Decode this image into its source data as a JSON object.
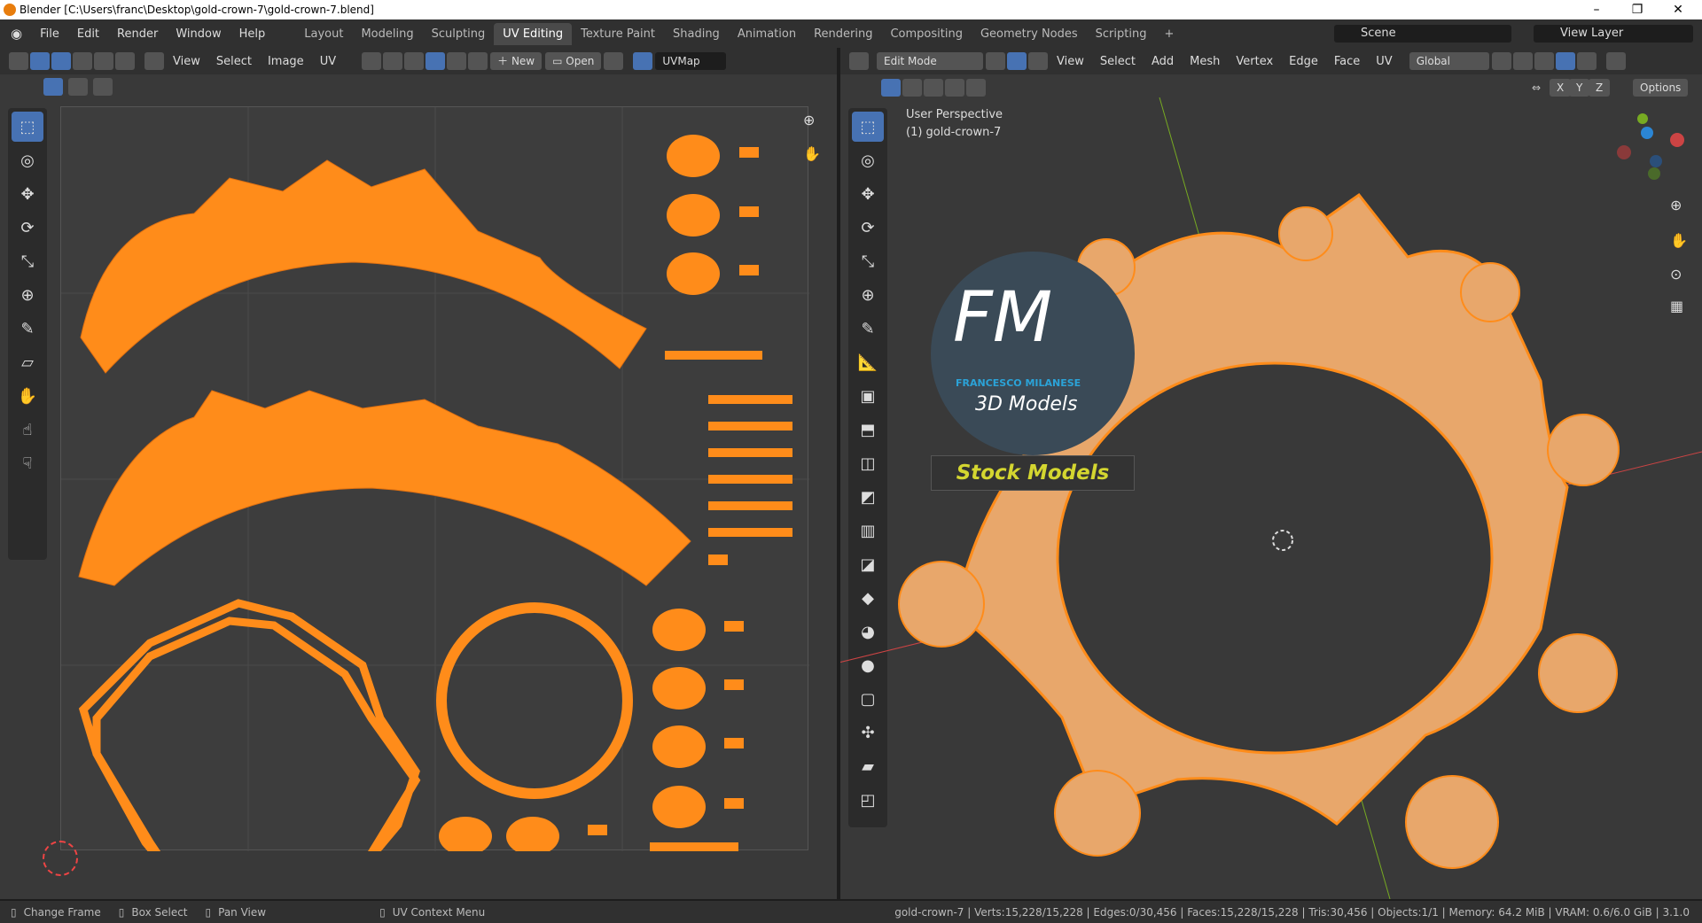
{
  "window": {
    "title": "Blender [C:\\Users\\franc\\Desktop\\gold-crown-7\\gold-crown-7.blend]",
    "minimize": "–",
    "maximize": "❐",
    "close": "✕"
  },
  "menu": [
    "File",
    "Edit",
    "Render",
    "Window",
    "Help"
  ],
  "workspaces": [
    "Layout",
    "Modeling",
    "Sculpting",
    "UV Editing",
    "Texture Paint",
    "Shading",
    "Animation",
    "Rendering",
    "Compositing",
    "Geometry Nodes",
    "Scripting"
  ],
  "active_workspace": "UV Editing",
  "scene": "Scene",
  "view_layer": "View Layer",
  "uv_header": {
    "menus": [
      "View",
      "Select",
      "Image",
      "UV"
    ],
    "new_label": "New",
    "open_label": "Open",
    "uvmap": "UVMap"
  },
  "viewport_header": {
    "mode": "Edit Mode",
    "menus": [
      "View",
      "Select",
      "Add",
      "Mesh",
      "Vertex",
      "Edge",
      "Face",
      "UV"
    ],
    "transform": "Global",
    "axes": [
      "X",
      "Y",
      "Z"
    ],
    "options": "Options"
  },
  "viewport_overlay": {
    "line1": "User Perspective",
    "line2": "(1) gold-crown-7"
  },
  "watermark": {
    "logo": "FM",
    "name": "FRANCESCO MILANESE",
    "tagline": "3D Models",
    "banner": "Stock Models"
  },
  "statusbar": {
    "change_frame": "Change Frame",
    "box_select": "Box Select",
    "pan_view": "Pan View",
    "context_menu": "UV Context Menu",
    "stats": "gold-crown-7 | Verts:15,228/15,228 | Edges:0/30,456 | Faces:15,228/15,228 | Tris:30,456 | Objects:1/1 | Memory: 64.2 MiB | VRAM: 0.6/6.0 GiB | 3.1.0"
  },
  "colors": {
    "accent": "#4772b3",
    "uv": "#ff8c1a",
    "mesh": "#e8a76b"
  }
}
